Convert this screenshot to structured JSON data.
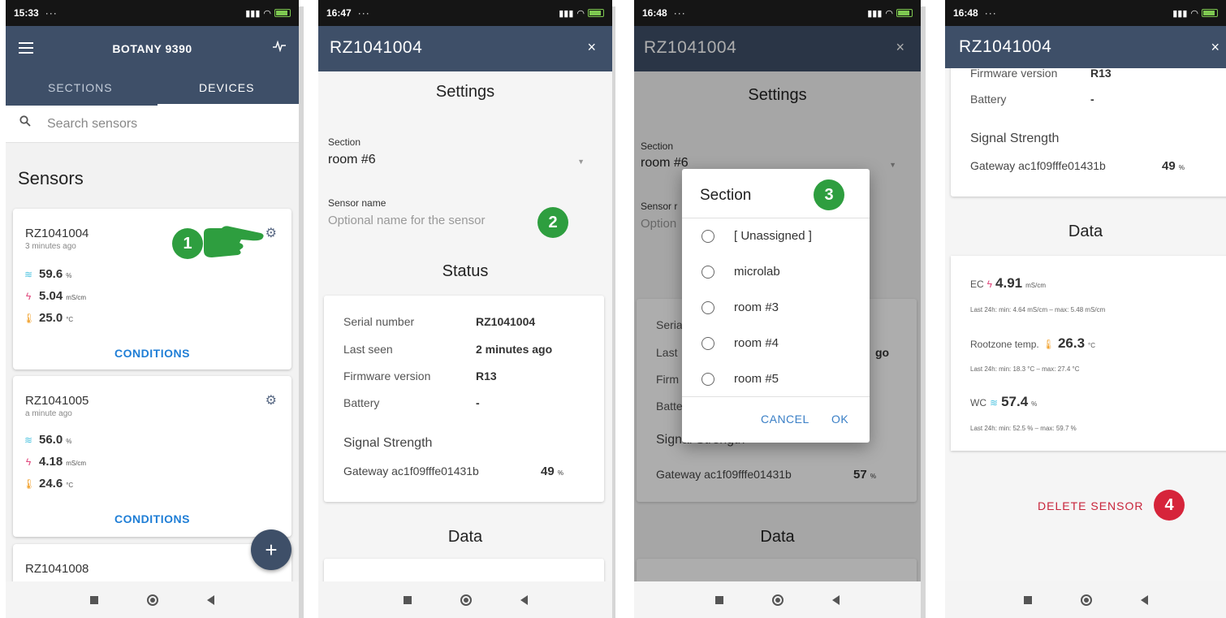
{
  "colors": {
    "appbar": "#3e4f68",
    "accent_link": "#1f7ed6",
    "badge_green": "#2e9e3f",
    "badge_red": "#d6243a",
    "delete_red": "#c8243a"
  },
  "phone1": {
    "status_time": "15:33",
    "status_dots": "···",
    "app_title": "BOTANY 9390",
    "tabs": [
      "SECTIONS",
      "DEVICES"
    ],
    "active_tab": "DEVICES",
    "search_placeholder": "Search sensors",
    "heading": "Sensors",
    "cards": [
      {
        "id": "RZ1041004",
        "ago": "3 minutes ago",
        "wc": "59.6",
        "wc_unit": "%",
        "ec": "5.04",
        "ec_unit": "mS/cm",
        "temp": "25.0",
        "temp_unit": "°C",
        "button": "CONDITIONS"
      },
      {
        "id": "RZ1041005",
        "ago": "a minute ago",
        "wc": "56.0",
        "wc_unit": "%",
        "ec": "4.18",
        "ec_unit": "mS/cm",
        "temp": "24.6",
        "temp_unit": "°C",
        "button": "CONDITIONS"
      },
      {
        "id": "RZ1041008"
      }
    ],
    "fab_label": "+",
    "step_badge": "1"
  },
  "phone2": {
    "status_time": "16:47",
    "status_dots": "···",
    "title": "RZ1041004",
    "close": "×",
    "settings_heading": "Settings",
    "section_label": "Section",
    "section_value": "room #6",
    "sensor_name_label": "Sensor name",
    "sensor_name_placeholder": "Optional name for the sensor",
    "step_badge": "2",
    "status_heading": "Status",
    "status_rows": [
      {
        "label": "Serial number",
        "value": "RZ1041004"
      },
      {
        "label": "Last seen",
        "value": "2 minutes ago"
      },
      {
        "label": "Firmware version",
        "value": "R13"
      },
      {
        "label": "Battery",
        "value": "-"
      }
    ],
    "signal_heading": "Signal Strength",
    "gateway": "Gateway ac1f09fffe01431b",
    "signal_value": "49",
    "signal_unit": "%",
    "data_heading": "Data"
  },
  "phone3": {
    "status_time": "16:48",
    "status_dots": "···",
    "title": "RZ1041004",
    "close": "×",
    "settings_heading": "Settings",
    "section_label": "Section",
    "section_value": "room #6",
    "sensor_name_label": "Sensor r",
    "sensor_name_placeholder": "Option",
    "bg_rows": [
      "Seria",
      "Last",
      "Firm",
      "Batte"
    ],
    "bg_last_seen_tail": "go",
    "signal_heading": "Signal Strength",
    "gateway": "Gateway ac1f09fffe01431b",
    "signal_value": "57",
    "signal_unit": "%",
    "data_heading": "Data",
    "dialog": {
      "title": "Section",
      "options": [
        "[ Unassigned ]",
        "microlab",
        "room #3",
        "room #4",
        "room #5"
      ],
      "cancel": "CANCEL",
      "ok": "OK"
    },
    "step_badge": "3"
  },
  "phone4": {
    "status_time": "16:48",
    "status_dots": "···",
    "title": "RZ1041004",
    "close": "×",
    "firmware_label": "Firmware version",
    "firmware_value": "R13",
    "battery_label": "Battery",
    "battery_value": "-",
    "signal_heading": "Signal Strength",
    "gateway": "Gateway ac1f09fffe01431b",
    "signal_value": "49",
    "signal_unit": "%",
    "data_heading": "Data",
    "ec_label": "EC",
    "ec_value": "4.91",
    "ec_unit": "mS/cm",
    "ec_range": "Last 24h: min: 4.64 mS/cm – max: 5.48 mS/cm",
    "temp_label": "Rootzone temp.",
    "temp_value": "26.3",
    "temp_unit": "°C",
    "temp_range": "Last 24h: min: 18.3 °C – max: 27.4 °C",
    "wc_label": "WC",
    "wc_value": "57.4",
    "wc_unit": "%",
    "wc_range": "Last 24h: min: 52.5 % – max: 59.7 %",
    "delete_label": "DELETE SENSOR",
    "step_badge": "4"
  }
}
